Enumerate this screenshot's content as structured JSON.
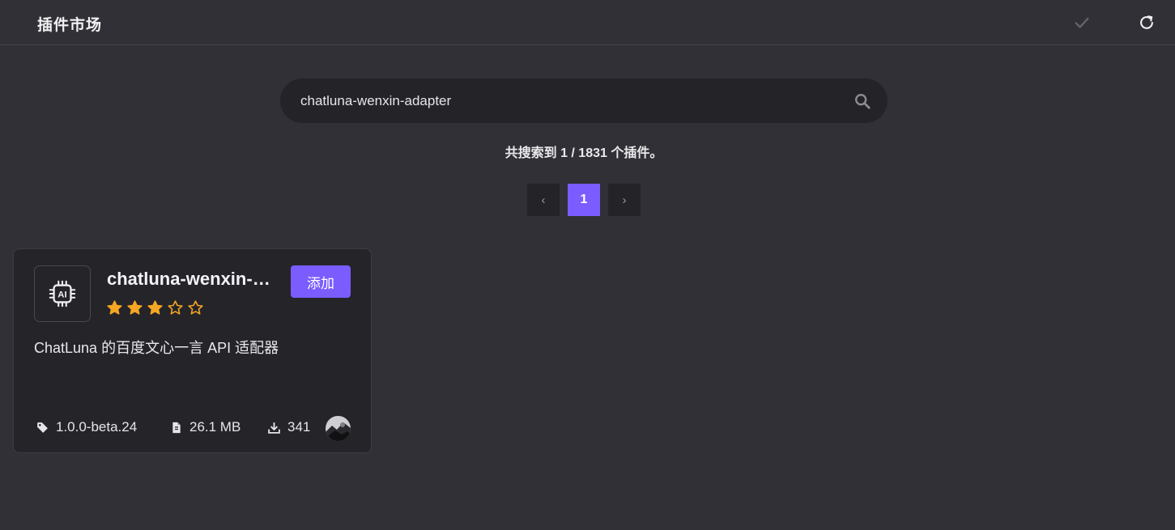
{
  "header": {
    "title": "插件市场"
  },
  "search": {
    "value": "chatluna-wenxin-adapter"
  },
  "results": {
    "summary": "共搜索到 1 / 1831 个插件。"
  },
  "pagination": {
    "prev": "‹",
    "current_page": "1",
    "next": "›"
  },
  "plugin": {
    "name": "chatluna-wenxin-adapter",
    "icon_text": "AI",
    "rating": 3,
    "rating_max": 5,
    "add_label": "添加",
    "description": "ChatLuna 的百度文心一言 API 适配器",
    "version": "1.0.0-beta.24",
    "size": "26.1 MB",
    "downloads": "341"
  },
  "colors": {
    "background": "#313036",
    "surface": "#252429",
    "accent": "#7a5cff",
    "star": "#f5a623"
  }
}
